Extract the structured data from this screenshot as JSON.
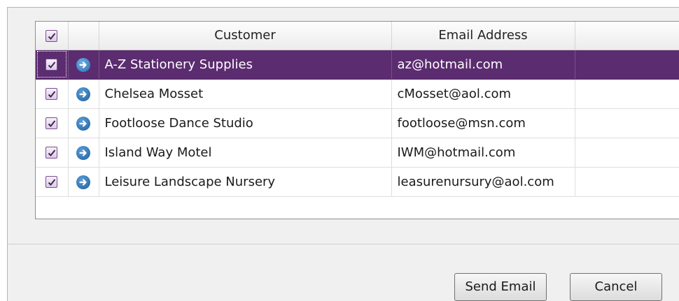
{
  "grid": {
    "columns": {
      "select_all_checked": true,
      "arrow": "",
      "customer": "Customer",
      "email": "Email Address",
      "extra": ""
    },
    "rows": [
      {
        "checked": true,
        "customer": "A-Z Stationery Supplies",
        "email": "az@hotmail.com",
        "selected": true
      },
      {
        "checked": true,
        "customer": "Chelsea Mosset",
        "email": "cMosset@aol.com",
        "selected": false
      },
      {
        "checked": true,
        "customer": "Footloose Dance Studio",
        "email": "footloose@msn.com",
        "selected": false
      },
      {
        "checked": true,
        "customer": "Island Way Motel",
        "email": "IWM@hotmail.com",
        "selected": false
      },
      {
        "checked": true,
        "customer": "Leisure Landscape Nursery",
        "email": "leasurenursury@aol.com",
        "selected": false
      }
    ],
    "row_icon": "arrow-right-circle-icon",
    "checkbox_icon": "checkmark-icon"
  },
  "buttons": {
    "send_email": "Send Email",
    "cancel": "Cancel"
  },
  "colors": {
    "selection": "#5b2c6f",
    "checkbox_border": "#7a4f8e",
    "arrow_blue": "#1c5c9c"
  }
}
